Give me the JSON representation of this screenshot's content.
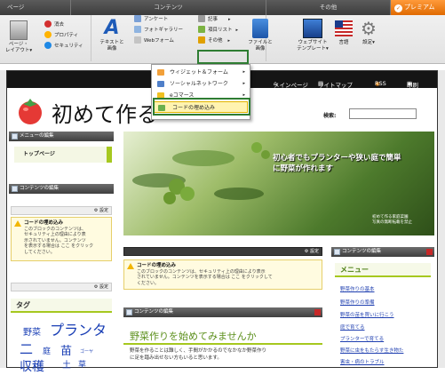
{
  "ribbon": {
    "tabs": [
      "ページ",
      "コンテンツ",
      "その他"
    ],
    "premium_label": "プレミアム",
    "page_group": {
      "layout_label_1": "ページ・",
      "layout_label_2": "レイアウト▾",
      "delete": "消去",
      "property": "プロパティ",
      "security": "セキュリティ"
    },
    "content_group": {
      "text_image_1": "テキストと",
      "text_image_2": "画像",
      "questionnaire": "アンケート",
      "photo_gallery": "フォトギャラリー",
      "web_form": "Webフォーム",
      "article": "記事",
      "item_list": "項目リスト",
      "other": "その他",
      "file_image_1": "ファイルと",
      "file_image_2": "画像"
    },
    "other_group": {
      "website_template_1": "ウェブサイト",
      "website_template_2": "テンプレート▾",
      "language": "言語",
      "settings": "設定▾"
    },
    "dropdown": [
      "ウィジェット＆フォーム",
      "ソーシャルネットワーク",
      "eコマース",
      "コードの埋め込み"
    ]
  },
  "site": {
    "nav": {
      "main_page": "メインページ",
      "sitemap": "サイトマップ",
      "rss": "RSS",
      "print": "印刷"
    },
    "title": "初めて作る",
    "search_label": "検索:",
    "menu_edit": "メニューの編集",
    "top_page": "トップページ",
    "content_edit": "コンテンツの編集",
    "settings": "設定",
    "embed_notice": {
      "title": "コードの埋め込み",
      "body_1": "このブロックのコンテンツは、",
      "body_2": "セキュリティ上の理由により表",
      "body_3": "示されていません。コンテンツ",
      "body_4": "を表示する場合は ここ をクリック",
      "body_5": "してください。"
    },
    "center_notice": {
      "title": "コードの埋め込み",
      "line_1": "このブロックのコンテンツは、セキュリティ上の理由により表示",
      "line_2": "されていません。コンテンツを表示する場合は ここ をクリックして",
      "line_3": "ください。"
    },
    "tag_title": "タグ",
    "tags": [
      "野菜",
      "プランタ",
      "二",
      "庭",
      "苗",
      "ゴーヤ",
      "収穫",
      "土",
      "草"
    ],
    "hero_text_1": "初心者でもプランターや狭い庭で簡単",
    "hero_text_2": "に野菜が作れます",
    "hero_caption_1": "初めて作る家庭菜園",
    "hero_caption_2": "写真の無断転載を禁止",
    "center_content_title": "コンテンツの編集",
    "center_heading": "野菜作りを始めてみませんか",
    "center_body_1": "野菜を作ることは難しく、手間がかかるのでなかなか野菜作り",
    "center_body_2": "に足を踏み出せない方もいると思います。",
    "right_content_title": "コンテンツの編集",
    "right_menu_title": "メニュー",
    "right_menu": [
      "野菜作りの基本",
      "野菜作りの準備",
      "野菜の苗を買いに行こう",
      "庭で育てる",
      "プランターで育てる",
      "野菜に虫をもたらす生き物た",
      "害虫・病のトラブル"
    ]
  }
}
